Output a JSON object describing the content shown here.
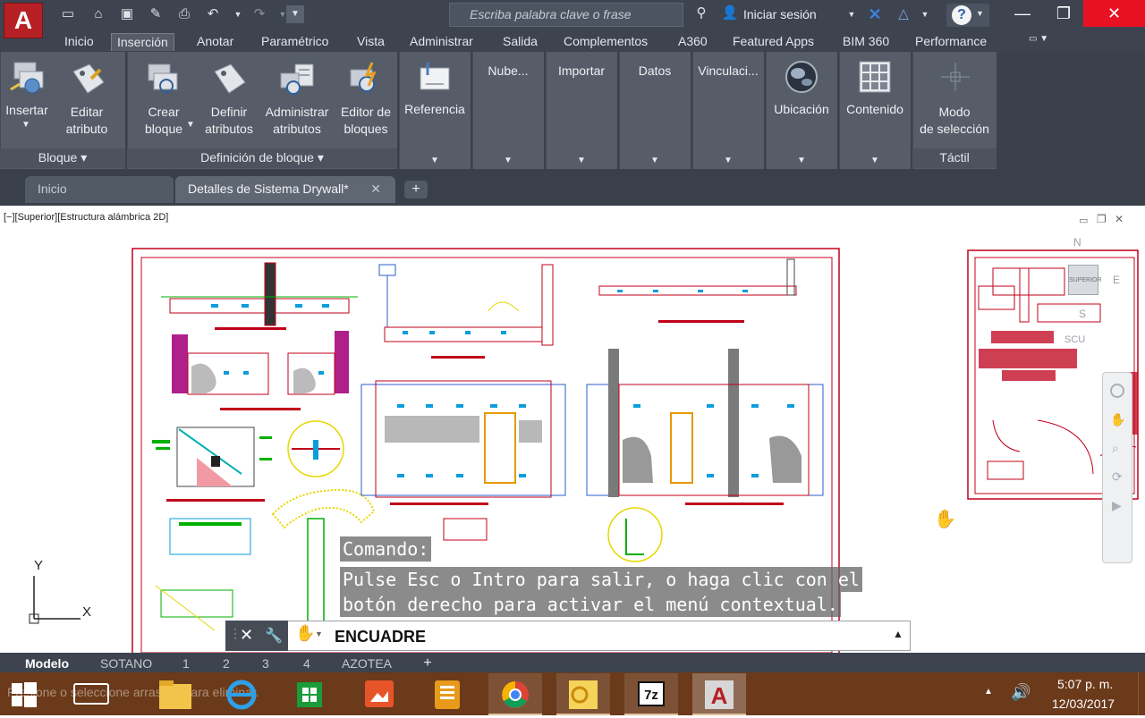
{
  "titlebar": {
    "search_placeholder": "Escriba palabra clave o frase",
    "signin_label": "Iniciar sesión",
    "help_icon": "question-circle-icon"
  },
  "ribbon_tabs": [
    "Inicio",
    "Inserción",
    "Anotar",
    "Paramétrico",
    "Vista",
    "Administrar",
    "Salida",
    "Complementos",
    "A360",
    "Featured Apps",
    "BIM 360",
    "Performance"
  ],
  "ribbon_active_tab": "Inserción",
  "panels": {
    "bloque": {
      "title": "Bloque",
      "buttons": [
        {
          "label": [
            "Insertar",
            ""
          ],
          "icon": "insert-block-icon"
        },
        {
          "label": [
            "Editar",
            "atributo"
          ],
          "icon": "edit-attribute-icon"
        }
      ]
    },
    "definicion": {
      "title": "Definición de bloque",
      "buttons": [
        {
          "label": [
            "Crear",
            "bloque"
          ],
          "icon": "create-block-icon"
        },
        {
          "label": [
            "Definir",
            "atributos"
          ],
          "icon": "define-attributes-icon"
        },
        {
          "label": [
            "Administrar",
            "atributos"
          ],
          "icon": "manage-attributes-icon"
        },
        {
          "label": [
            "Editor de",
            "bloques"
          ],
          "icon": "block-editor-icon"
        }
      ]
    },
    "referencia": {
      "title": "Referencia"
    },
    "nube": {
      "title": "Nube..."
    },
    "importar": {
      "title": "Importar"
    },
    "datos": {
      "title": "Datos"
    },
    "vinculacion": {
      "title": "Vinculaci..."
    },
    "ubicacion": {
      "title": "Ubicación"
    },
    "contenido": {
      "title": "Contenido"
    },
    "tactil": {
      "title": "Táctil",
      "button_label": [
        "Modo",
        "de selección"
      ]
    }
  },
  "document_tabs": {
    "home": "Inicio",
    "active": "Detalles de Sistema Drywall*"
  },
  "viewport": {
    "label": "[−][Superior][Estructura alámbrica 2D]",
    "viewcube": {
      "face": "SUPERIOR",
      "north": "N",
      "east": "E",
      "south": "S",
      "wcs": "SCU"
    }
  },
  "command": {
    "prompt": "Comando:",
    "message_line1": "Pulse Esc o Intro para salir, o haga clic con el",
    "message_line2": "botón derecho para activar el menú contextual.",
    "current": "ENCUADRE"
  },
  "layout_tabs": [
    "Modelo",
    "SOTANO",
    "1",
    "2",
    "3",
    "4",
    "AZOTEA"
  ],
  "layout_active": "Modelo",
  "taskbar": {
    "time": "5:07 p. m.",
    "date": "12/03/2017",
    "hint": "Presione o seleccione arrastrar para eliminar."
  },
  "ucs": {
    "x": "X",
    "y": "Y"
  },
  "colors": {
    "accent_red": "#b52025",
    "drawing_red": "#c0001a",
    "ribbon_bg": "#565d69",
    "titlebar_bg": "#3d4450",
    "taskbar_bg": "#6b3a1a"
  }
}
